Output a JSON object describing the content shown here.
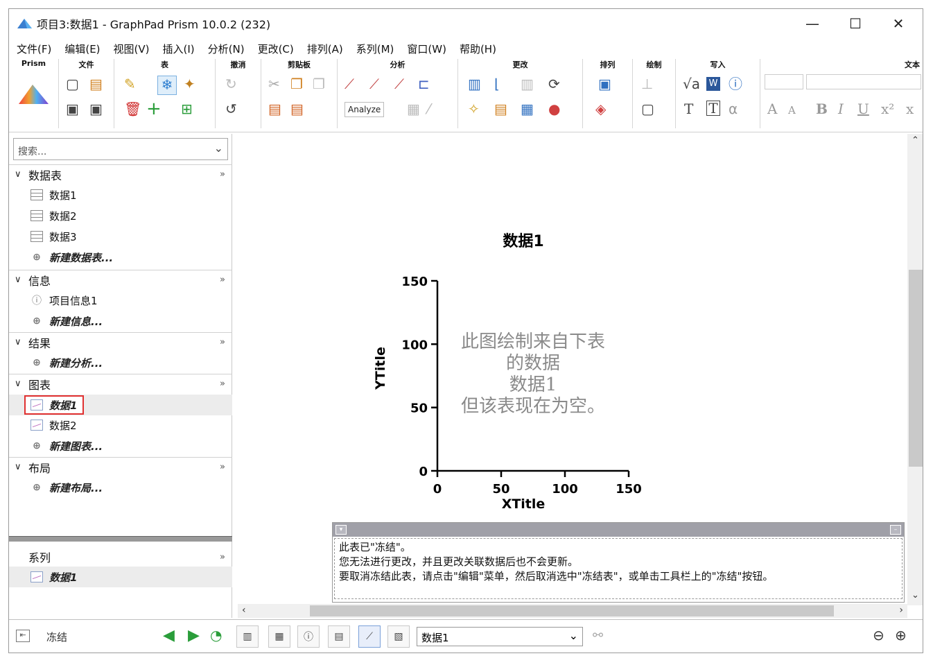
{
  "window": {
    "title": "项目3:数据1 - GraphPad Prism 10.0.2 (232)",
    "minimize": "—",
    "maximize": "☐",
    "close": "✕"
  },
  "menu": [
    "文件(F)",
    "编辑(E)",
    "视图(V)",
    "插入(I)",
    "分析(N)",
    "更改(C)",
    "排列(A)",
    "系列(M)",
    "窗口(W)",
    "帮助(H)"
  ],
  "ribbon": {
    "groups": [
      "Prism",
      "文件",
      "表",
      "撤消",
      "剪贴板",
      "分析",
      "更改",
      "排列",
      "绘制",
      "写入",
      "文本"
    ],
    "analyze_label": "Analyze"
  },
  "navigator": {
    "search_placeholder": "搜索...",
    "sections": {
      "data_tables": {
        "label": "数据表",
        "items": [
          "数据1",
          "数据2",
          "数据3"
        ],
        "new": "新建数据表..."
      },
      "info": {
        "label": "信息",
        "items": [
          "项目信息1"
        ],
        "new": "新建信息..."
      },
      "results": {
        "label": "结果",
        "new": "新建分析..."
      },
      "graphs": {
        "label": "图表",
        "items": [
          "数据1",
          "数据2"
        ],
        "new": "新建图表..."
      },
      "layouts": {
        "label": "布局",
        "new": "新建布局..."
      }
    },
    "family": {
      "label": "系列",
      "item": "数据1"
    },
    "more": "»"
  },
  "chart_data": {
    "type": "scatter",
    "title": "数据1",
    "xlabel": "XTitle",
    "ylabel": "YTitle",
    "xlim": [
      0,
      150
    ],
    "ylim": [
      0,
      150
    ],
    "xticks": [
      "0",
      "50",
      "100",
      "150"
    ],
    "yticks": [
      "0",
      "50",
      "100",
      "150"
    ],
    "series": [],
    "placeholder_lines": [
      "此图绘制来自下表",
      "的数据",
      "数据1",
      "但该表现在为空。"
    ]
  },
  "frozen_notice": {
    "lines": [
      "此表已\"冻结\"。",
      "您无法进行更改，并且更改关联数据后也不会更新。",
      "要取消冻结此表，请点击\"编辑\"菜单，然后取消选中\"冻结表\"，或单击工具栏上的\"冻结\"按钮。"
    ]
  },
  "statusbar": {
    "freeze_label": "冻结",
    "sheet_select": "数据1"
  },
  "colors": {
    "selection_border": "#e03030",
    "nav_green": "#2a9d3a",
    "axis": "#000000"
  }
}
